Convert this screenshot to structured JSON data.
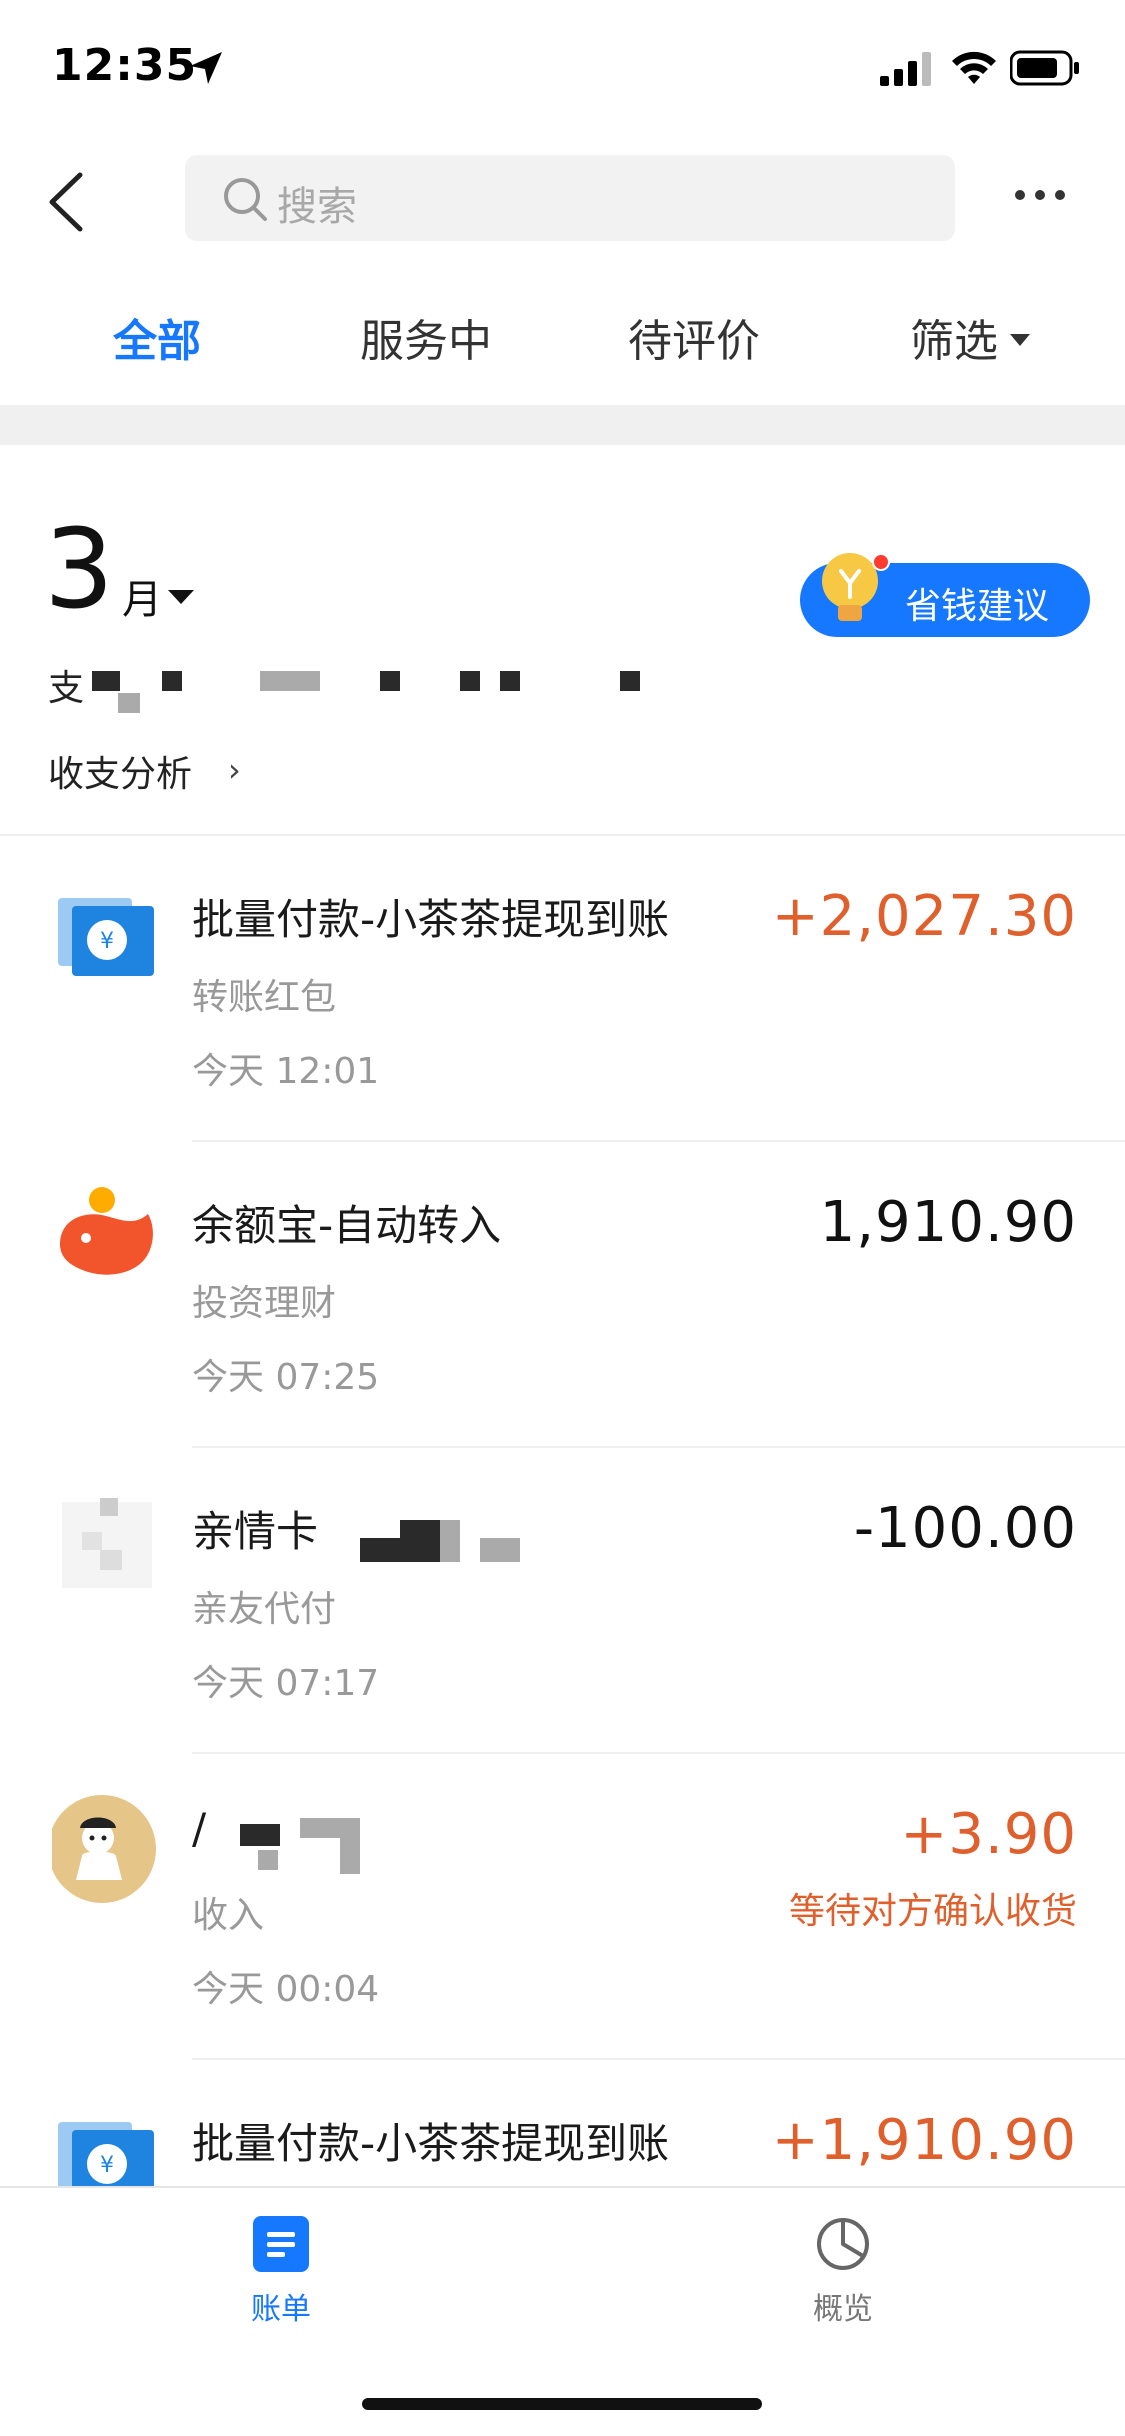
{
  "status_bar": {
    "time": "12:35"
  },
  "search": {
    "placeholder": "搜索"
  },
  "tabs": [
    {
      "label": "全部",
      "active": true
    },
    {
      "label": "服务中",
      "active": false
    },
    {
      "label": "待评价",
      "active": false
    },
    {
      "label": "筛选",
      "active": false
    }
  ],
  "month_header": {
    "month": "3",
    "month_unit": "月",
    "spend_label": "支",
    "analysis_link": "收支分析",
    "save_tip_button": "省钱建议"
  },
  "transactions": [
    {
      "icon": "transfer-icon",
      "title": "批量付款-小茶茶提现到账",
      "category": "转账红包",
      "time": "今天  12:01",
      "amount": "+2,027.30",
      "type": "positive"
    },
    {
      "icon": "yuebao-icon",
      "title": "余额宝-自动转入",
      "category": "投资理财",
      "time": "今天  07:25",
      "amount": "1,910.90",
      "type": "neutral"
    },
    {
      "icon": "family-card-icon",
      "title": "亲情卡",
      "category": "亲友代付",
      "time": "今天  07:17",
      "amount": "-100.00",
      "type": "neutral"
    },
    {
      "icon": "avatar-icon",
      "title": "/",
      "category": "收入",
      "time": "今天  00:04",
      "amount": "+3.90",
      "type": "positive",
      "status": "等待对方确认收货"
    },
    {
      "icon": "transfer-icon",
      "title": "批量付款-小茶茶提现到账",
      "category": "",
      "time": "",
      "amount": "+1,910.90",
      "type": "positive"
    }
  ],
  "bottom_nav": [
    {
      "label": "账单",
      "active": true,
      "icon": "bill-icon"
    },
    {
      "label": "概览",
      "active": false,
      "icon": "overview-pie-icon"
    }
  ],
  "colors": {
    "accent": "#1677ff",
    "income": "#e0602d",
    "muted": "#999999"
  }
}
